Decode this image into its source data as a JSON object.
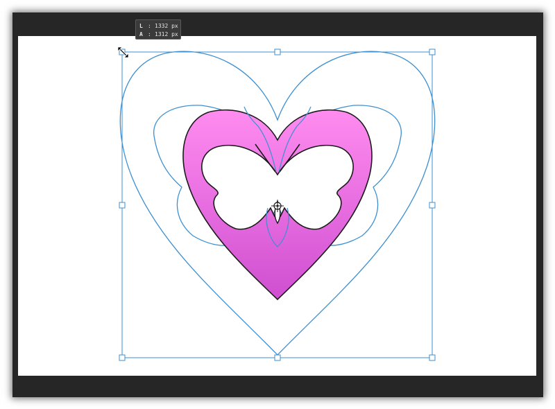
{
  "tooltip": {
    "width_key": "L",
    "width_value": "1332 px",
    "height_key": "A",
    "height_value": "1312 px",
    "separator": ":"
  },
  "colors": {
    "frame_dark": "#262626",
    "canvas": "#ffffff",
    "path_outline": "#3b8fd1",
    "heart_fill_top": "#ff8cf0",
    "heart_fill_bottom": "#cf4fd0",
    "selection": "#3b8fd1"
  },
  "icons": {
    "transform_cursor": "resize-diagonal-icon",
    "reference_point": "crosshair-icon"
  }
}
